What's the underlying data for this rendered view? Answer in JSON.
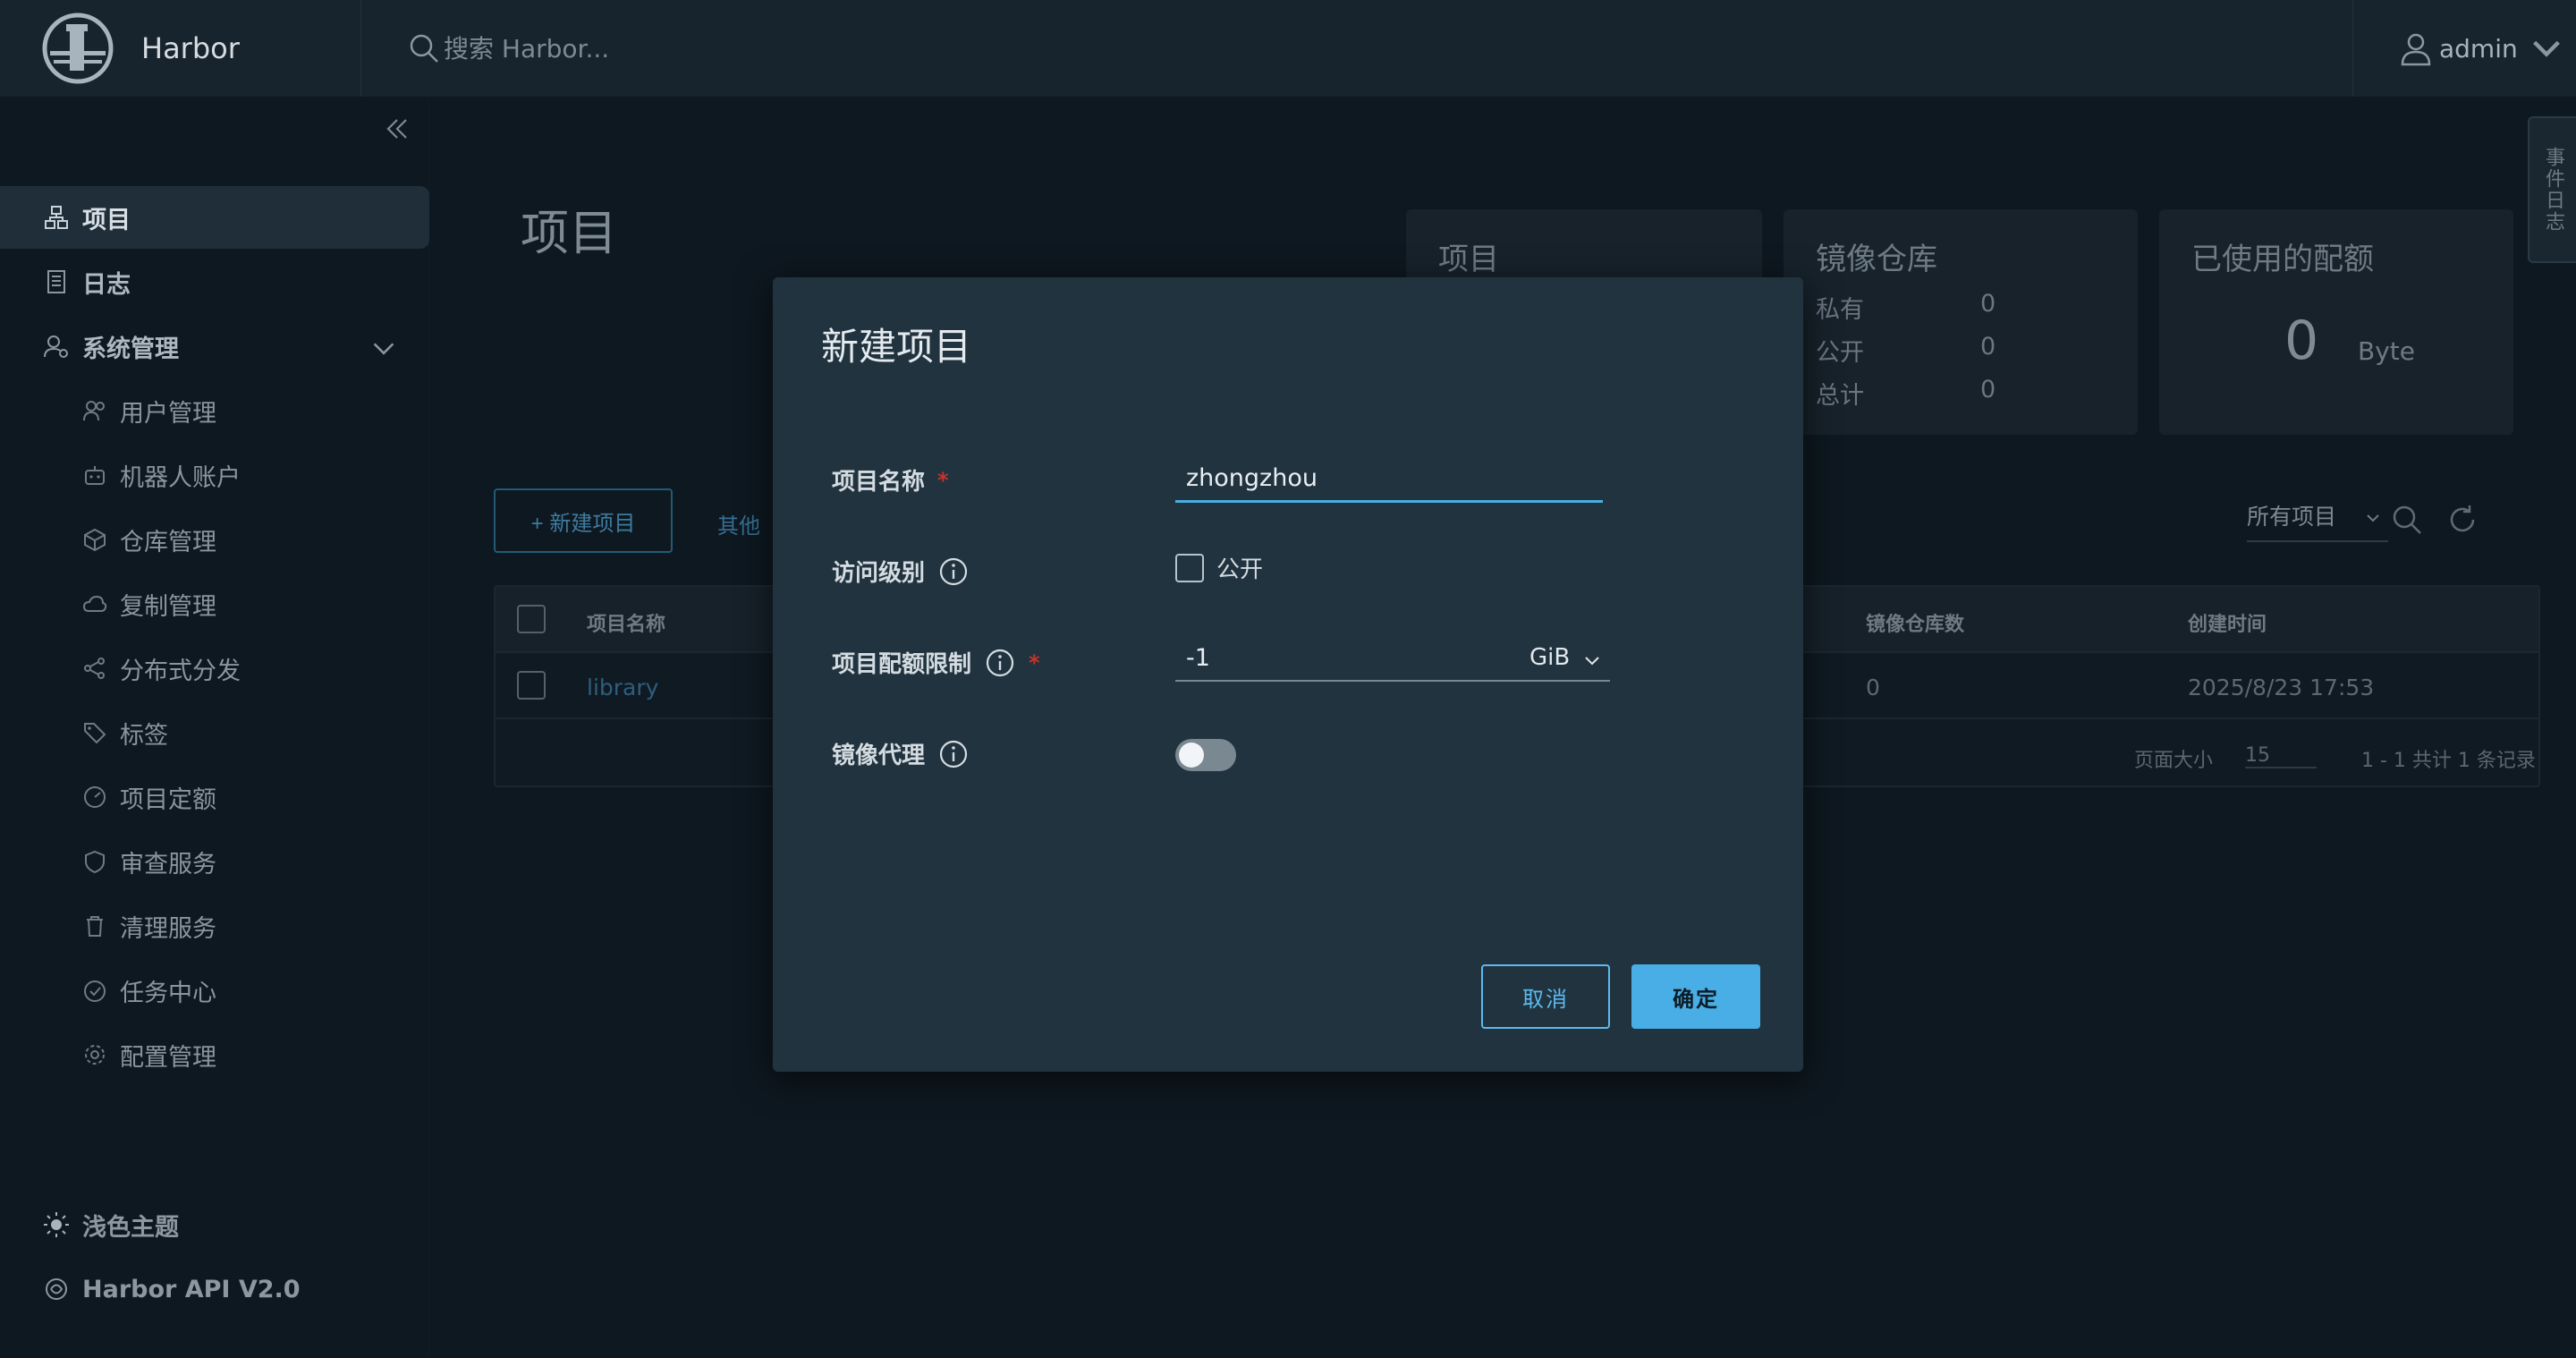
{
  "header": {
    "brand": "Harbor",
    "search_placeholder": "搜索 Harbor...",
    "user": "admin"
  },
  "sidebar": {
    "items": [
      {
        "label": "项目"
      },
      {
        "label": "日志"
      },
      {
        "label": "系统管理"
      }
    ],
    "admin_items": [
      {
        "label": "用户管理"
      },
      {
        "label": "机器人账户"
      },
      {
        "label": "仓库管理"
      },
      {
        "label": "复制管理"
      },
      {
        "label": "分布式分发"
      },
      {
        "label": "标签"
      },
      {
        "label": "项目定额"
      },
      {
        "label": "审查服务"
      },
      {
        "label": "清理服务"
      },
      {
        "label": "任务中心"
      },
      {
        "label": "配置管理"
      }
    ],
    "footer": {
      "theme": "浅色主题",
      "api": "Harbor API V2.0"
    }
  },
  "main": {
    "title": "项目",
    "cards": {
      "projects": {
        "title": "项目"
      },
      "repos": {
        "title": "镜像仓库",
        "rows": [
          {
            "label": "私有",
            "value": "0"
          },
          {
            "label": "公开",
            "value": "0"
          },
          {
            "label": "总计",
            "value": "0"
          }
        ]
      },
      "quota": {
        "title": "已使用的配额",
        "value": "0",
        "unit": "Byte"
      }
    },
    "toolbar": {
      "new_project": "+ 新建项目",
      "other": "其他",
      "filter": "所有项目"
    },
    "table": {
      "columns": [
        "项目名称",
        "镜像仓库数",
        "创建时间"
      ],
      "rows": [
        {
          "name": "library",
          "repo_count": "0",
          "created": "2025/8/23 17:53"
        }
      ],
      "footer": {
        "page_size_label": "页面大小",
        "page_size": "15",
        "summary": "1 - 1 共计 1 条记录"
      }
    },
    "side_tab": "事件日志"
  },
  "modal": {
    "title": "新建项目",
    "fields": {
      "name_label": "项目名称",
      "name_value": "zhongzhou",
      "access_label": "访问级别",
      "public_label": "公开",
      "quota_label": "项目配额限制",
      "quota_value": "-1",
      "quota_unit": "GiB",
      "proxy_label": "镜像代理"
    },
    "buttons": {
      "cancel": "取消",
      "ok": "确定"
    }
  },
  "colors": {
    "accent": "#49aee6",
    "modal_bg": "#21333f",
    "required": "#c5332b"
  }
}
